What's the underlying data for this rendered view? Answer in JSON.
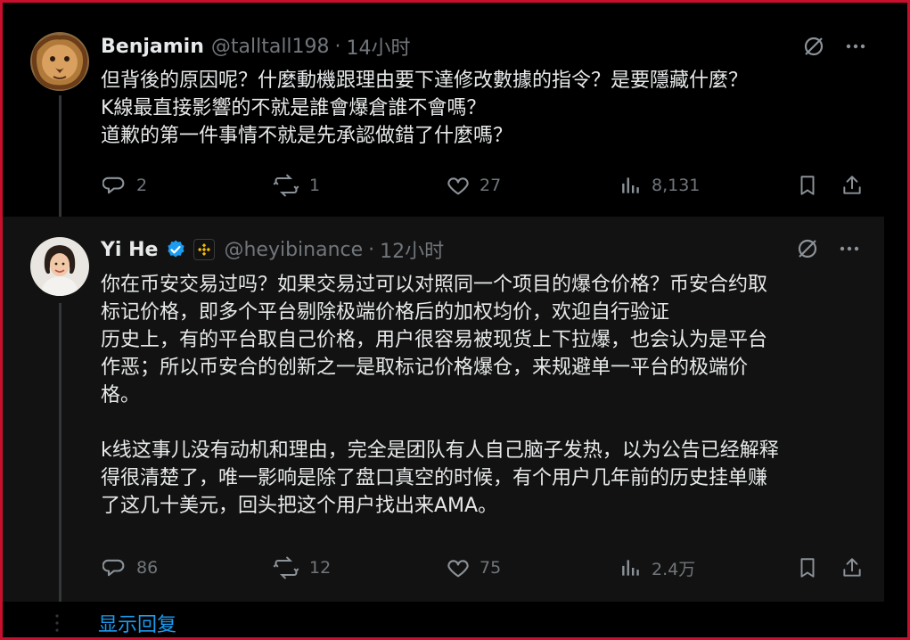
{
  "tweets": [
    {
      "author": "Benjamin",
      "handle": "@talltall198",
      "dot": "·",
      "time": "14小时",
      "lines": [
        "但背後的原因呢？什麼動機跟理由要下達修改數據的指令？是要隱藏什麼？",
        "K線最直接影響的不就是誰會爆倉誰不會嗎？",
        "道歉的第一件事情不就是先承認做錯了什麼嗎？"
      ],
      "replies": "2",
      "reposts": "1",
      "likes": "27",
      "views": "8,131",
      "avatar_icon": "lion-avatar-icon"
    },
    {
      "author": "Yi He",
      "handle": "@heyibinance",
      "dot": "·",
      "time": "12小时",
      "verified_color": "#1d9bf0",
      "affiliate_color": "#f0b90b",
      "lines": [
        "你在币安交易过吗？如果交易过可以对照同一个项目的爆仓价格？币安合约取",
        "标记价格，即多个平台剔除极端价格后的加权均价，欢迎自行验证",
        "历史上，有的平台取自己价格，用户很容易被现货上下拉爆，也会认为是平台",
        "作恶；所以币安合的创新之一是取标记价格爆仓，来规避单一平台的极端价",
        "格。",
        "",
        "k线这事儿没有动机和理由，完全是团队有人自己脑子发热，以为公告已经解释",
        "得很清楚了，唯一影响是除了盘口真空的时候，有个用户几年前的历史挂单赚",
        "了这几十美元，回头把这个用户找出来AMA。"
      ],
      "replies": "86",
      "reposts": "12",
      "likes": "75",
      "views": "2.4万",
      "avatar_icon": "woman-portrait-avatar-icon"
    }
  ],
  "show_replies_label": "显示回复",
  "colors": {
    "background": "#000000",
    "highlight_background": "#121212",
    "text": "#e7e9ea",
    "muted": "#71767b",
    "link": "#1d9bf0",
    "frame_border": "#c8102e"
  }
}
